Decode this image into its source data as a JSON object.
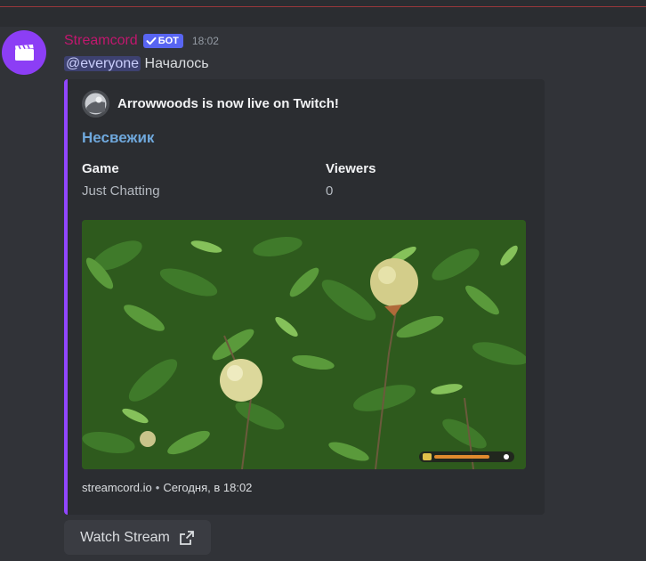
{
  "message": {
    "username": "Streamcord",
    "bot_tag": "БОТ",
    "timestamp": "18:02",
    "mention": "@everyone",
    "text": "Началось"
  },
  "embed": {
    "accent_color": "#9146ff",
    "author": "Arrowwoods is now live on Twitch!",
    "title": "Несвежик",
    "fields": [
      {
        "name": "Game",
        "value": "Just Chatting"
      },
      {
        "name": "Viewers",
        "value": "0"
      }
    ],
    "footer": {
      "site": "streamcord.io",
      "separator": "•",
      "time": "Сегодня, в 18:02"
    },
    "image_alt": "stream preview: green pomegranate tree with fruits"
  },
  "button": {
    "label": "Watch Stream",
    "icon": "external-link-icon"
  }
}
